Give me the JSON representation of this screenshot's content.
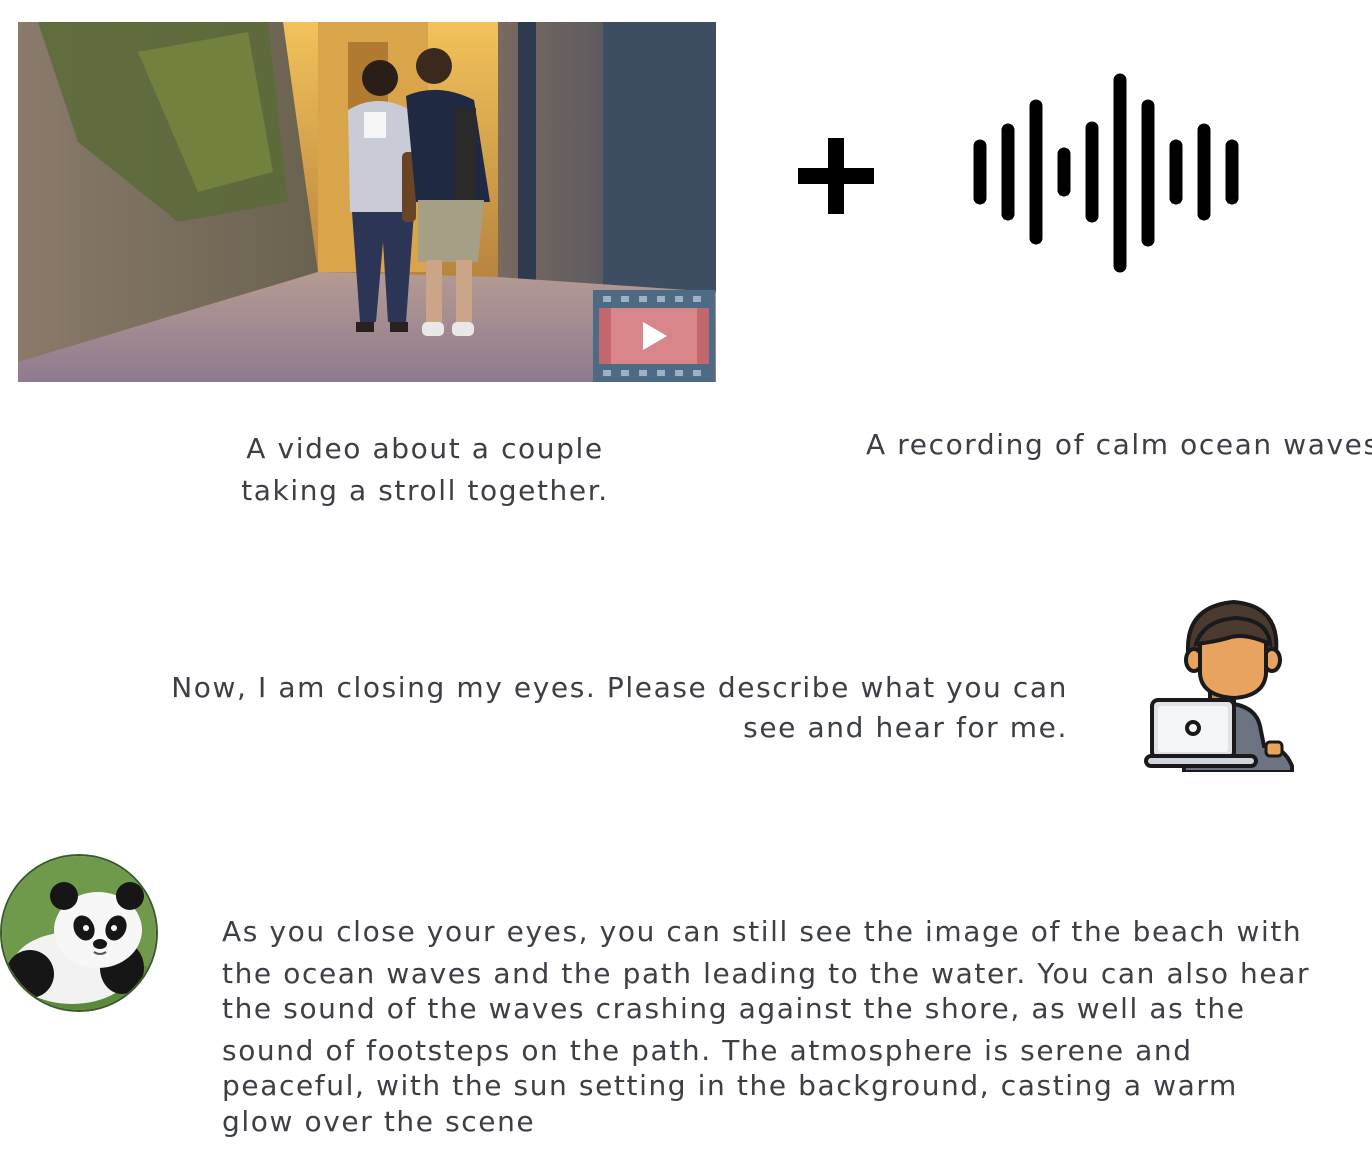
{
  "video": {
    "caption_line1": "A video about a couple",
    "caption_line2": "taking a stroll together."
  },
  "audio": {
    "caption": "A recording of calm ocean waves."
  },
  "plus_symbol": "+",
  "icons": {
    "video": "film-play-icon",
    "audio": "sound-waveform-icon",
    "user": "user-with-laptop-icon",
    "assistant": "panda-avatar-icon"
  },
  "prompt": {
    "line1": "Now, I am closing my eyes. Please describe what you can",
    "line2": "see and hear for me."
  },
  "response": {
    "lines": [
      "As you close your eyes, you can still see the image of the beach with",
      "the ocean waves and the path leading to the water. You can also hear",
      "the sound of the waves crashing against the shore, as well as the",
      "sound of footsteps on the path. The atmosphere is serene and",
      "peaceful, with the sun setting in the background, casting a warm",
      "glow over the scene"
    ]
  },
  "colors": {
    "text": "#3c3f45",
    "film_frame": "#4e6b85",
    "film_screen": "#d9868a",
    "skin": "#e8a35f",
    "hair": "#4a3a30",
    "shirt": "#6b7480"
  }
}
